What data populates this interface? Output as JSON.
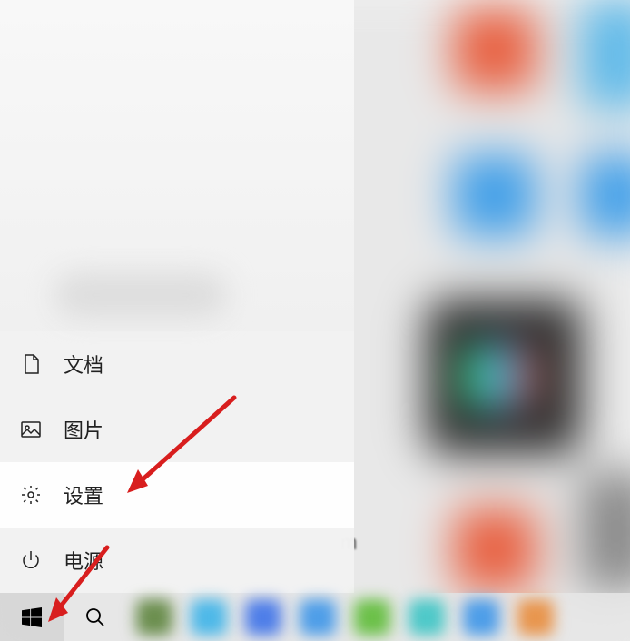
{
  "startMenu": {
    "items": [
      {
        "label": "文档",
        "icon": "document"
      },
      {
        "label": "图片",
        "icon": "image"
      },
      {
        "label": "设置",
        "icon": "gear",
        "highlighted": true
      },
      {
        "label": "电源",
        "icon": "power"
      }
    ]
  },
  "annotations": {
    "arrows": [
      {
        "target": "settings-menu-item"
      },
      {
        "target": "start-button"
      }
    ]
  },
  "backgroundHint": "m"
}
